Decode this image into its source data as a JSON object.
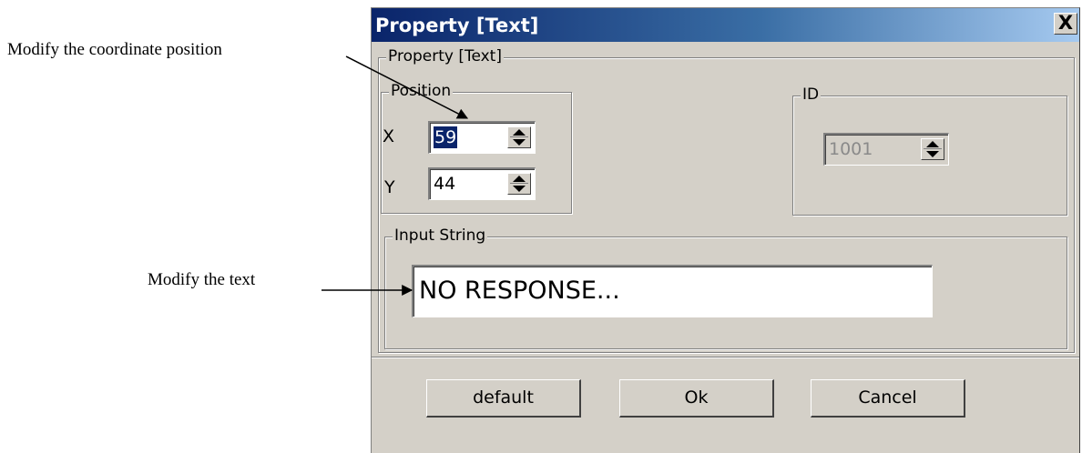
{
  "annotations": {
    "coordinate": "Modify the coordinate position",
    "text": "Modify the text"
  },
  "dialog": {
    "title": "Property [Text]",
    "close_label": "X",
    "main_group_label": "Property [Text]",
    "position": {
      "label": "Position",
      "x_label": "X",
      "x_value": "59",
      "y_label": "Y",
      "y_value": "44"
    },
    "id": {
      "label": "ID",
      "value": "1001"
    },
    "input_string": {
      "label": "Input String",
      "value": "NO RESPONSE..."
    },
    "buttons": {
      "default": "default",
      "ok": "Ok",
      "cancel": "Cancel"
    }
  },
  "colors": {
    "title_start": "#0a246a",
    "title_end": "#a6caf0",
    "dialog_bg": "#d4d0c8",
    "selection": "#0a246a"
  }
}
